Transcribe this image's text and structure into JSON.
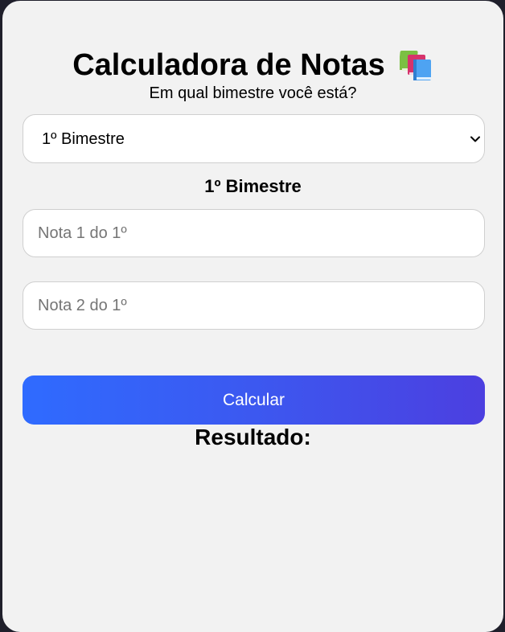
{
  "header": {
    "title": "Calculadora de Notas",
    "icon": "books-icon",
    "subtitle": "Em qual bimestre você está?"
  },
  "bimester_select": {
    "selected": "1º Bimestre",
    "icon": "chevron-down-icon"
  },
  "section": {
    "label": "1º Bimestre"
  },
  "inputs": {
    "nota1_placeholder": "Nota 1 do 1º",
    "nota1_value": "",
    "nota2_placeholder": "Nota 2 do 1º",
    "nota2_value": ""
  },
  "actions": {
    "calculate_label": "Calcular"
  },
  "result": {
    "label": "Resultado:"
  },
  "colors": {
    "card_background": "#f2f2f2",
    "page_background": "#1f1f2b",
    "button_gradient_start": "#2f6bff",
    "button_gradient_end": "#4c3fe0",
    "button_text": "#ffffff"
  }
}
